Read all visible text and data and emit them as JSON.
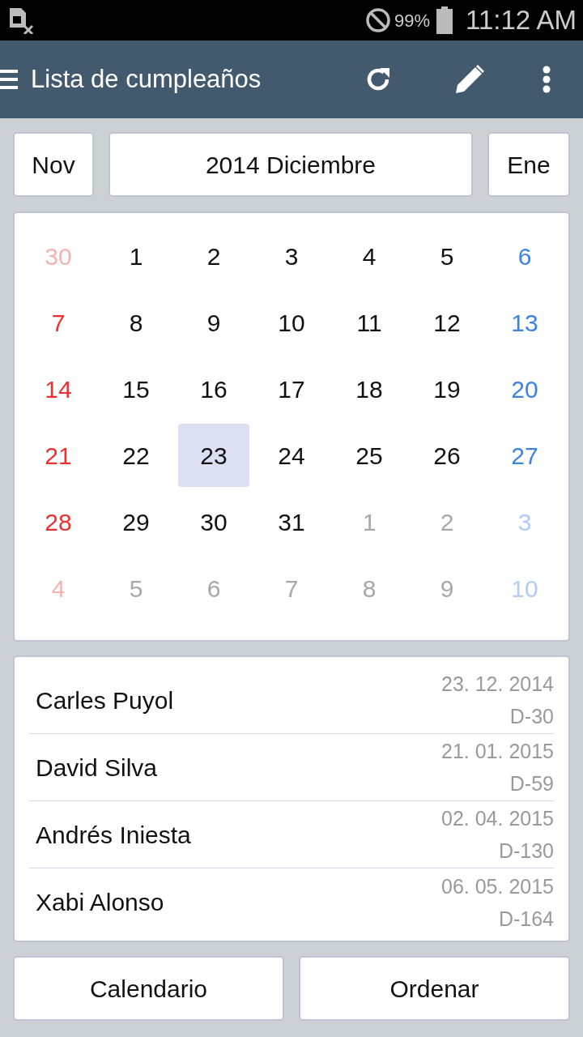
{
  "status_bar": {
    "battery": "99%",
    "time": "11:12 AM"
  },
  "toolbar": {
    "title": "Lista de cumpleaños"
  },
  "month_nav": {
    "prev": "Nov",
    "current": "2014 Diciembre",
    "next": "Ene"
  },
  "calendar": {
    "days": [
      {
        "label": "30",
        "kind": "prev",
        "selected": false
      },
      {
        "label": "1",
        "kind": "current",
        "selected": false
      },
      {
        "label": "2",
        "kind": "current",
        "selected": false
      },
      {
        "label": "3",
        "kind": "current",
        "selected": false
      },
      {
        "label": "4",
        "kind": "current",
        "selected": false
      },
      {
        "label": "5",
        "kind": "current",
        "selected": false
      },
      {
        "label": "6",
        "kind": "current",
        "selected": false
      },
      {
        "label": "7",
        "kind": "current",
        "selected": false
      },
      {
        "label": "8",
        "kind": "current",
        "selected": false
      },
      {
        "label": "9",
        "kind": "current",
        "selected": false
      },
      {
        "label": "10",
        "kind": "current",
        "selected": false
      },
      {
        "label": "11",
        "kind": "current",
        "selected": false
      },
      {
        "label": "12",
        "kind": "current",
        "selected": false
      },
      {
        "label": "13",
        "kind": "current",
        "selected": false
      },
      {
        "label": "14",
        "kind": "current",
        "selected": false
      },
      {
        "label": "15",
        "kind": "current",
        "selected": false
      },
      {
        "label": "16",
        "kind": "current",
        "selected": false
      },
      {
        "label": "17",
        "kind": "current",
        "selected": false
      },
      {
        "label": "18",
        "kind": "current",
        "selected": false
      },
      {
        "label": "19",
        "kind": "current",
        "selected": false
      },
      {
        "label": "20",
        "kind": "current",
        "selected": false
      },
      {
        "label": "21",
        "kind": "current",
        "selected": false
      },
      {
        "label": "22",
        "kind": "current",
        "selected": false
      },
      {
        "label": "23",
        "kind": "current",
        "selected": true
      },
      {
        "label": "24",
        "kind": "current",
        "selected": false
      },
      {
        "label": "25",
        "kind": "current",
        "selected": false
      },
      {
        "label": "26",
        "kind": "current",
        "selected": false
      },
      {
        "label": "27",
        "kind": "current",
        "selected": false
      },
      {
        "label": "28",
        "kind": "current",
        "selected": false
      },
      {
        "label": "29",
        "kind": "current",
        "selected": false
      },
      {
        "label": "30",
        "kind": "current",
        "selected": false
      },
      {
        "label": "31",
        "kind": "current",
        "selected": false
      },
      {
        "label": "1",
        "kind": "next",
        "selected": false
      },
      {
        "label": "2",
        "kind": "next",
        "selected": false
      },
      {
        "label": "3",
        "kind": "next",
        "selected": false
      },
      {
        "label": "4",
        "kind": "next",
        "selected": false
      },
      {
        "label": "5",
        "kind": "next",
        "selected": false
      },
      {
        "label": "6",
        "kind": "next",
        "selected": false
      },
      {
        "label": "7",
        "kind": "next",
        "selected": false
      },
      {
        "label": "8",
        "kind": "next",
        "selected": false
      },
      {
        "label": "9",
        "kind": "next",
        "selected": false
      },
      {
        "label": "10",
        "kind": "next",
        "selected": false
      }
    ]
  },
  "birthdays": [
    {
      "name": "Carles Puyol",
      "date": "23. 12. 2014",
      "countdown": "D-30"
    },
    {
      "name": "David Silva",
      "date": "21. 01. 2015",
      "countdown": "D-59"
    },
    {
      "name": "Andrés Iniesta",
      "date": "02. 04. 2015",
      "countdown": "D-130"
    },
    {
      "name": "Xabi Alonso",
      "date": "06. 05. 2015",
      "countdown": "D-164"
    }
  ],
  "buttons": [
    "Calendario",
    "Ordenar"
  ]
}
